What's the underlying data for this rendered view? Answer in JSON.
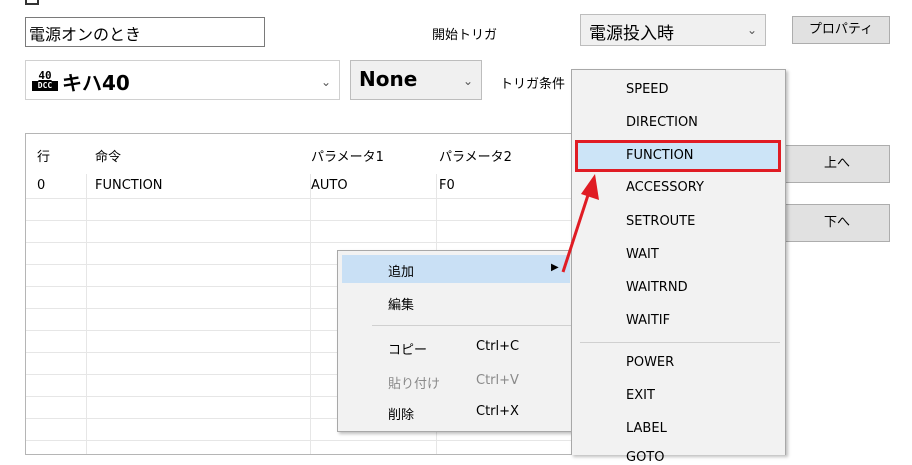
{
  "title_field": {
    "value": "電源オンのとき"
  },
  "trigger": {
    "label": "開始トリガ",
    "value": "電源投入時",
    "condition_label": "トリガ条件",
    "properties_button": "プロパティ"
  },
  "loco": {
    "badge_number": "40",
    "badge_text": "DCC",
    "name": "キハ40",
    "option": "None"
  },
  "grid": {
    "headers": [
      "行",
      "命令",
      "パラメータ1",
      "パラメータ2"
    ],
    "rows": [
      [
        "0",
        "FUNCTION",
        "AUTO",
        "F0"
      ]
    ]
  },
  "side_buttons": {
    "up": "上へ",
    "down": "下へ"
  },
  "context_menu": {
    "add": "追加",
    "edit": "編集",
    "copy": "コピー",
    "copy_shortcut": "Ctrl+C",
    "paste": "貼り付け",
    "paste_shortcut": "Ctrl+V",
    "delete": "削除",
    "delete_shortcut": "Ctrl+X"
  },
  "submenu": {
    "items": [
      "SPEED",
      "DIRECTION",
      "FUNCTION",
      "ACCESSORY",
      "SETROUTE",
      "WAIT",
      "WAITRND",
      "WAITIF",
      "POWER",
      "EXIT",
      "LABEL",
      "GOTO"
    ],
    "highlighted": "FUNCTION"
  },
  "colors": {
    "highlight_fill": "#cce4f7",
    "highlight_border": "#e01c24",
    "annotation_arrow": "#e01c24",
    "menu_bg": "#f2f2f2"
  },
  "icons": {
    "dropdown": "chevron-down-icon",
    "submenu": "triangle-right-icon"
  }
}
